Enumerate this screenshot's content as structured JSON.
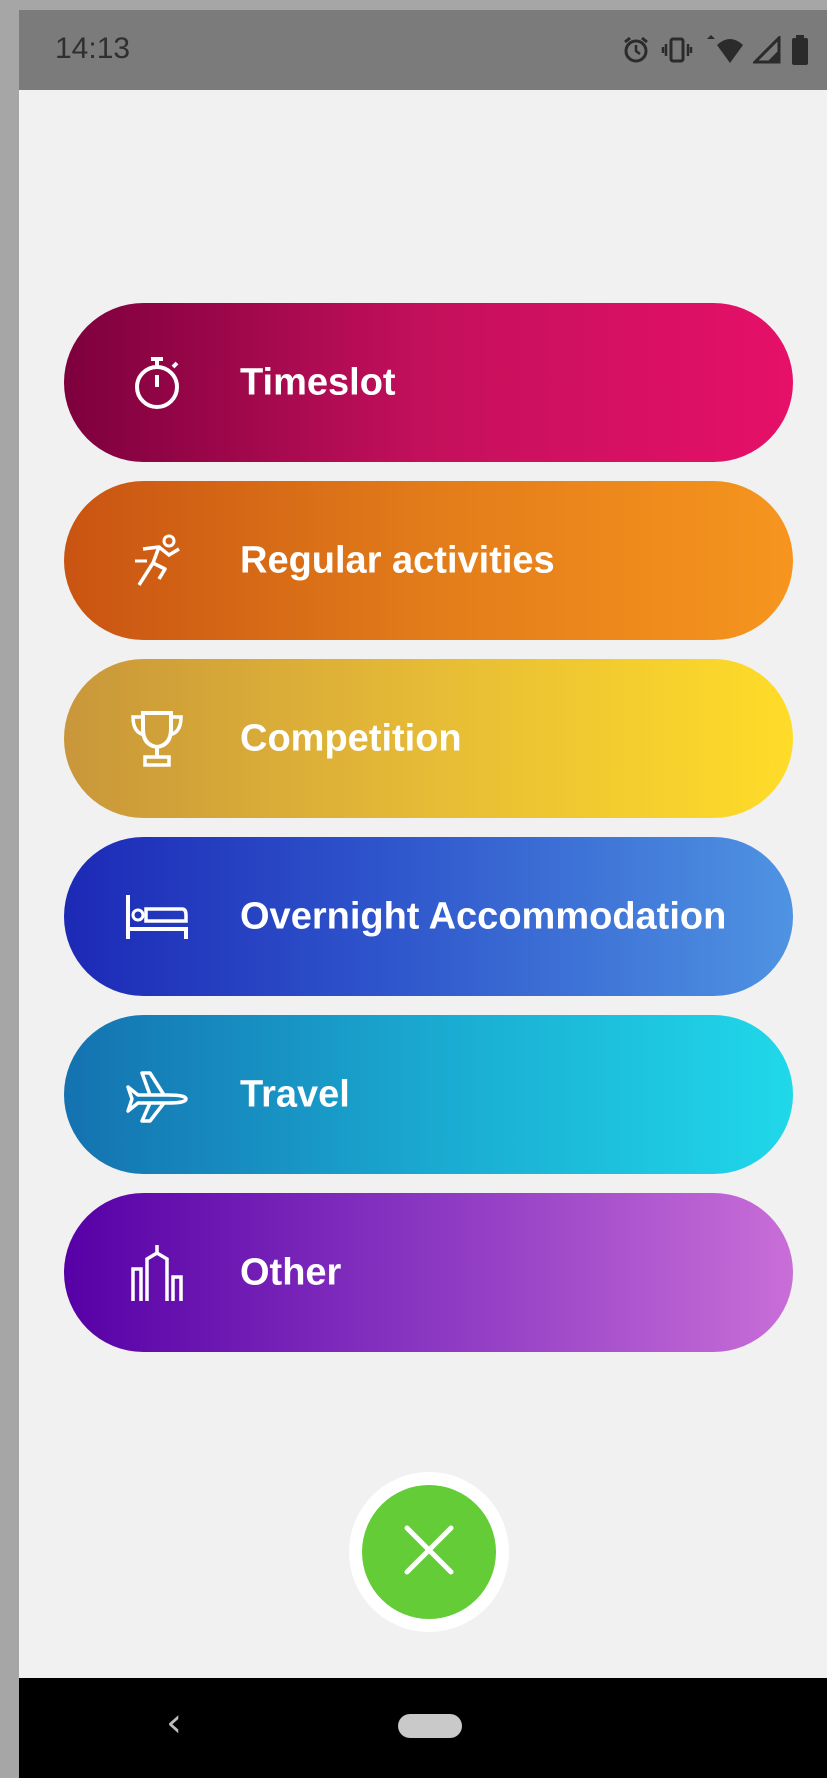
{
  "status_bar": {
    "time": "14:13",
    "icons": [
      "alarm-icon",
      "vibrate-icon",
      "wifi-icon",
      "signal-icon",
      "battery-icon"
    ]
  },
  "menu": {
    "items": [
      {
        "label": "Timeslot",
        "icon": "stopwatch-icon",
        "colors": [
          "#7d003c",
          "#e61068"
        ]
      },
      {
        "label": "Regular activities",
        "icon": "runner-icon",
        "colors": [
          "#c95412",
          "#f6951e"
        ]
      },
      {
        "label": "Competition",
        "icon": "trophy-icon",
        "colors": [
          "#c9973a",
          "#ffdc28"
        ]
      },
      {
        "label": "Overnight Accommodation",
        "icon": "bed-icon",
        "colors": [
          "#1c29b6",
          "#4f93e2"
        ]
      },
      {
        "label": "Travel",
        "icon": "airplane-icon",
        "colors": [
          "#1472b0",
          "#20d8ea"
        ]
      },
      {
        "label": "Other",
        "icon": "buildings-icon",
        "colors": [
          "#5600a6",
          "#c96ed8"
        ]
      }
    ]
  },
  "fab": {
    "icon": "close-icon",
    "color": "#63cc37"
  },
  "nav_bar": {
    "back_icon": "back-chevron-icon",
    "home_icon": "home-pill-icon"
  }
}
